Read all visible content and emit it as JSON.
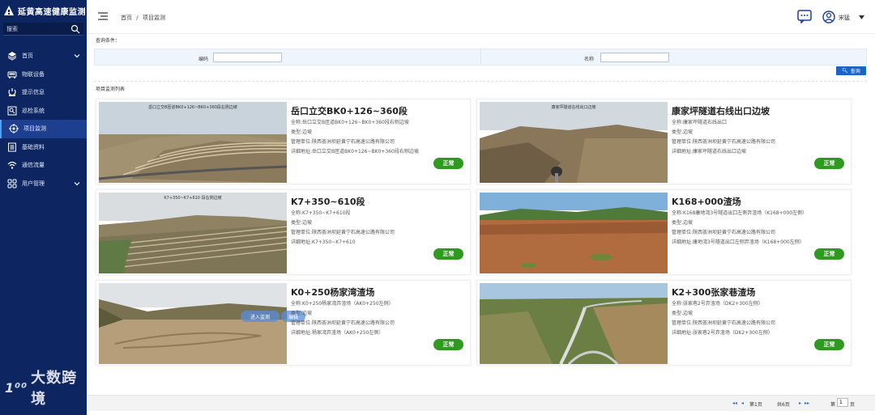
{
  "app": {
    "title": "延黄高速健康监测",
    "search_label": "搜索"
  },
  "sidebar": {
    "items": [
      {
        "label": "首页",
        "icon": "layers-icon",
        "has_caret": true
      },
      {
        "label": "物联设备",
        "icon": "device-icon",
        "has_caret": false
      },
      {
        "label": "提示信息",
        "icon": "alert-icon",
        "has_caret": false
      },
      {
        "label": "巡检系统",
        "icon": "inspection-icon",
        "has_caret": false
      },
      {
        "label": "项目监测",
        "icon": "target-icon",
        "has_caret": false,
        "active": true
      },
      {
        "label": "基础资料",
        "icon": "document-icon",
        "has_caret": false
      },
      {
        "label": "通信流量",
        "icon": "wifi-icon",
        "has_caret": false
      },
      {
        "label": "用户管理",
        "icon": "grid-icon",
        "has_caret": true
      }
    ]
  },
  "topbar": {
    "breadcrumb": [
      "首页",
      "/",
      "项目监测"
    ],
    "user_name": "宋猛"
  },
  "query": {
    "title": "查询条件：",
    "code_label": "编码",
    "code_value": "",
    "name_label": "名称",
    "name_value": "",
    "search_button": "查询"
  },
  "list": {
    "title": "项目监测列表",
    "cards": [
      {
        "title": "岳口立交BK0+126~360段",
        "full_name": "全称:岳口立交B匝道BK0+126~BK0+360段右侧边坡",
        "type": "类型:边坡",
        "unit": "管理单位:陕西荟洲坝延黄宁石高速公路有限公司",
        "address": "详细地址:岳口立交B匝道BK0+126~BK0+360段右侧边坡",
        "status": "正常",
        "photo_caption": "岳口立交B匝道BK0+126~BK0+360段右侧边坡"
      },
      {
        "title": "康家坪隧道右线出口边坡",
        "full_name": "全称:康家坪隧道右线出口",
        "type": "类型:边坡",
        "unit": "管理单位:陕西荟洲坝延黄宁石高速公路有限公司",
        "address": "详细地址:康家坪隧道右线出口边坡",
        "status": "正常",
        "photo_caption": "康家坪隧道右线出口边坡"
      },
      {
        "title": "K7+350~610段",
        "full_name": "全称:K7+350~K7+610段",
        "type": "类型:边坡",
        "unit": "管理单位:陕西荟洲坝延黄宁石高速公路有限公司",
        "address": "详细地址:K7+350~K7+610",
        "status": "正常",
        "photo_caption": "K7+350~K7+610 段右侧边坡"
      },
      {
        "title": "K168+000渣场",
        "full_name": "全称:K168康地湾3号隧道出口左侧弃渣场（K168+000左侧）",
        "type": "类型:边坡",
        "unit": "管理单位:陕西荟洲坝延黄宁石高速公路有限公司",
        "address": "详细地址:康地湾3号隧道出口左侧弃渣场（K168+000左侧）",
        "status": "正常",
        "photo_caption": ""
      },
      {
        "title": "K0+250杨家湾渣场",
        "full_name": "全称:K0+250杨家湾弃渣场（AK0+250左侧）",
        "type": "类型:边坡",
        "unit": "管理单位:陕西荟洲坝延黄宁石高速公路有限公司",
        "address": "详细地址:杨家湾弃渣场（AK0+250左侧）",
        "status": "正常",
        "photo_caption": "",
        "overlay_button": "进入监测",
        "overlay_button2": "编辑"
      },
      {
        "title": "K2+300张家巷渣场",
        "full_name": "全称:张家巷2号弃渣场（DK2+300左侧）",
        "type": "类型:边坡",
        "unit": "管理单位:陕西荟洲坝延黄宁石高速公路有限公司",
        "address": "详细地址:张家巷2号弃渣场（DK2+300左侧）",
        "status": "正常",
        "photo_caption": ""
      }
    ]
  },
  "pagination": {
    "first": "◂◂",
    "prev": "◂",
    "current": "第1页",
    "total": "共6页",
    "next": "▸",
    "last": "▸▸",
    "goto_label": "第",
    "goto_value": "1",
    "goto_suffix": "页"
  },
  "watermark": {
    "text": "大数跨境",
    "mark": "1⁰⁰"
  },
  "colors": {
    "sidebar_bg": "#0d2561",
    "sidebar_active": "#1e3f8f",
    "status_green": "#2e9a1f",
    "primary_blue": "#1c63c6"
  }
}
